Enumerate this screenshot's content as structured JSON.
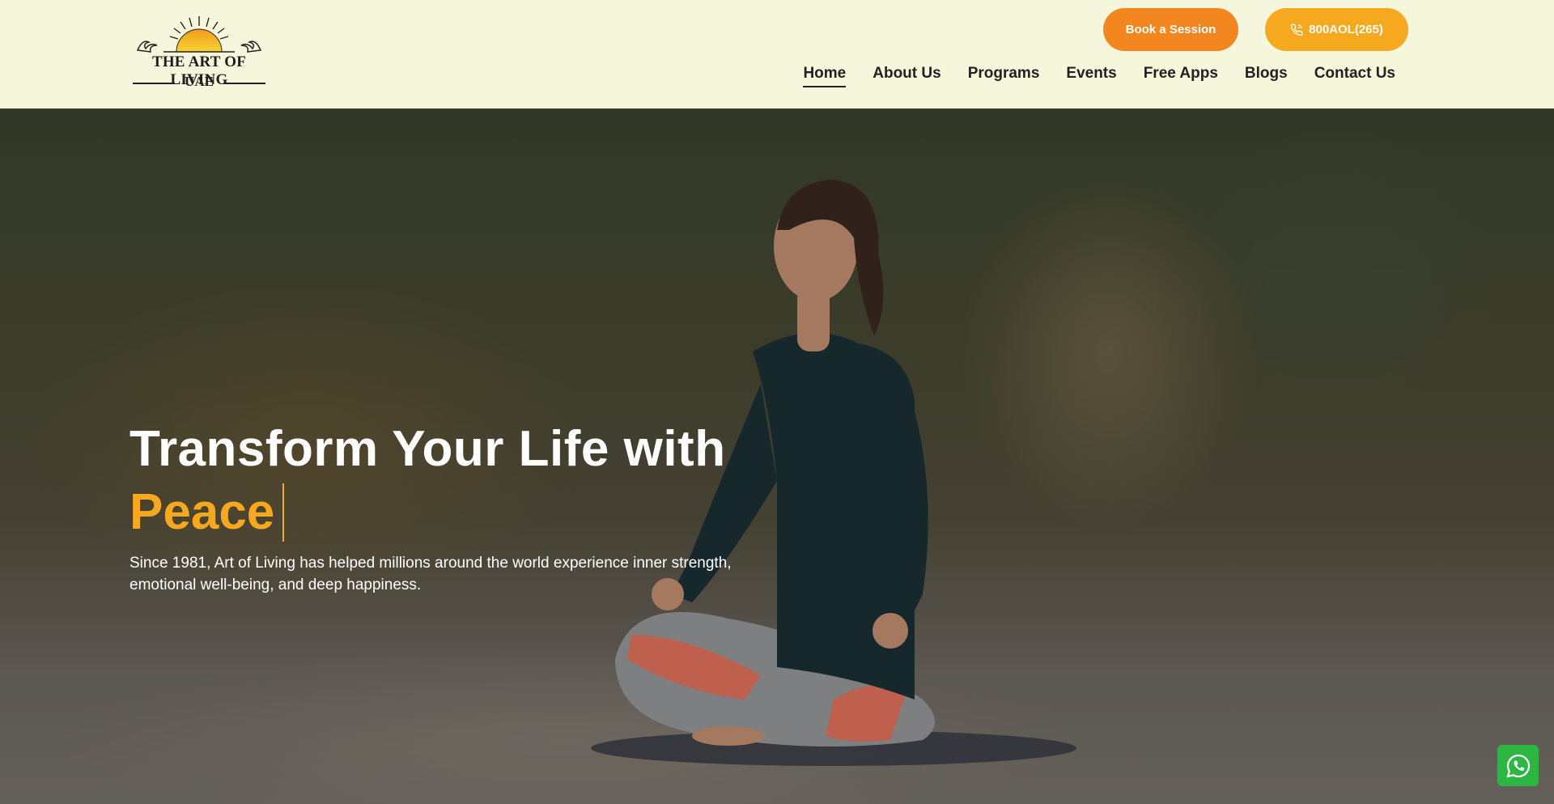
{
  "header": {
    "logo_text": "THE ART OF LIVING",
    "logo_sub": "UAE",
    "book_label": "Book a Session",
    "phone_label": "800AOL(265)",
    "nav": [
      {
        "label": "Home",
        "active": true
      },
      {
        "label": "About Us"
      },
      {
        "label": "Programs"
      },
      {
        "label": "Events"
      },
      {
        "label": "Free Apps"
      },
      {
        "label": "Blogs"
      },
      {
        "label": "Contact Us"
      }
    ]
  },
  "hero": {
    "title": "Transform Your Life with",
    "accent": "Peace",
    "description": "Since 1981, Art of Living has helped millions around the world experience inner strength, emotional well-being, and deep happiness."
  },
  "colors": {
    "header_bg": "#f6f6dc",
    "book_button": "#f4861f",
    "phone_button": "#f6a91e",
    "accent": "#f6a91e",
    "whatsapp": "#2db742"
  },
  "icons": {
    "phone": "phone-icon",
    "whatsapp": "whatsapp-icon",
    "logo": "sun-logo-icon"
  }
}
